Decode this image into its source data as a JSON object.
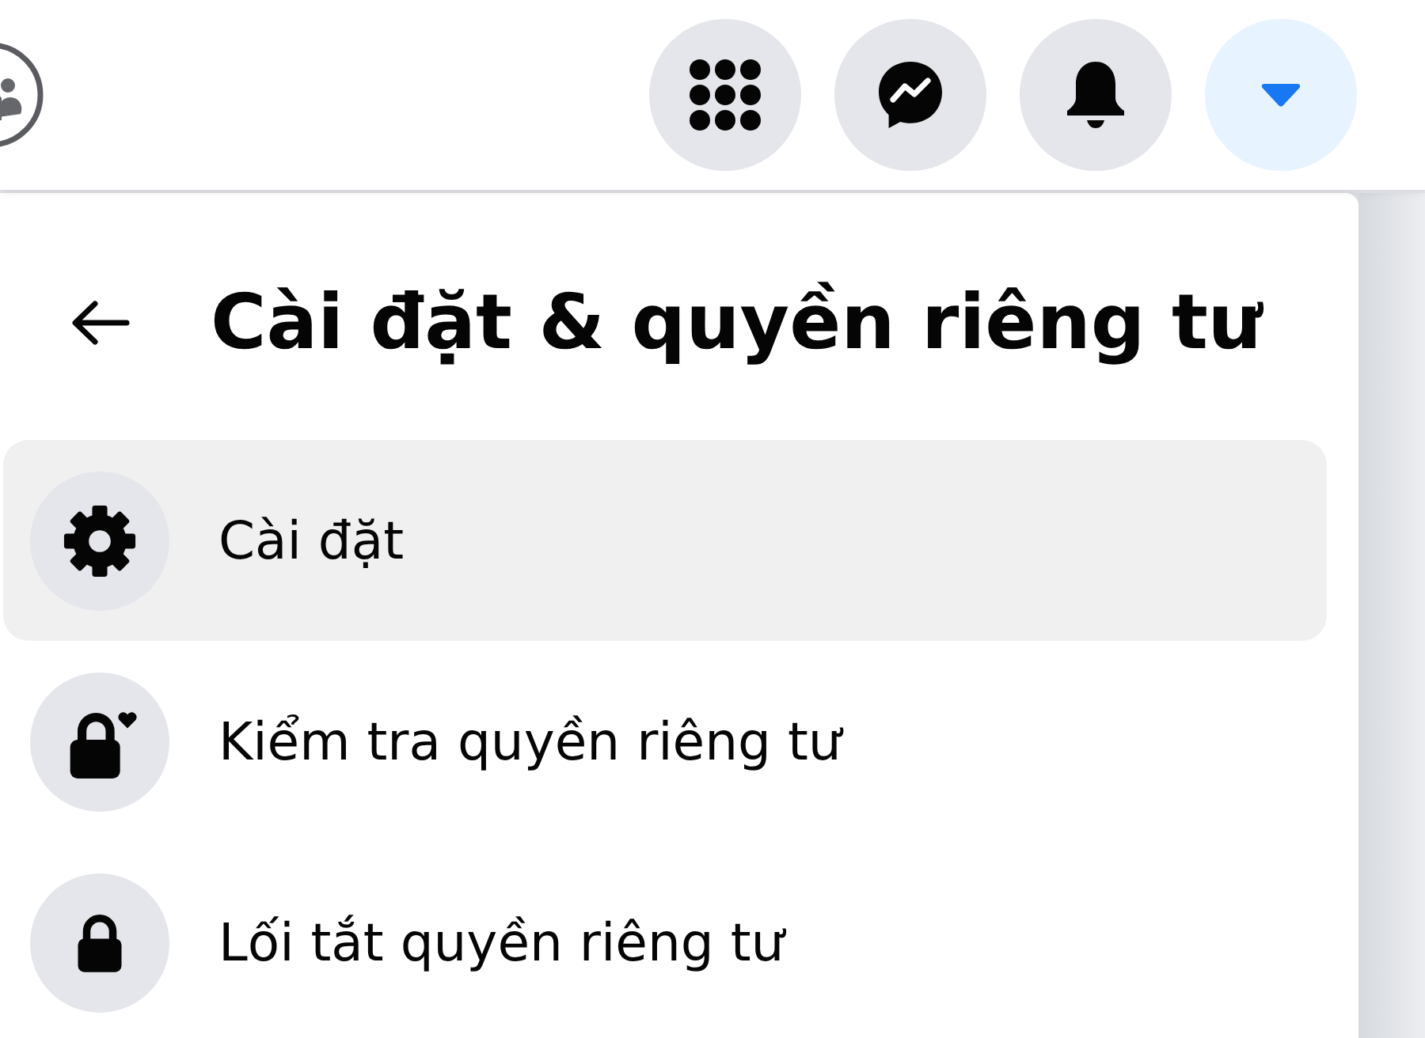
{
  "top_bar": {
    "buttons": [
      {
        "kind": "grid",
        "active": false
      },
      {
        "kind": "chat",
        "active": false
      },
      {
        "kind": "bell",
        "active": false
      },
      {
        "kind": "caret",
        "active": true
      }
    ]
  },
  "menu": {
    "title": "Cài đặt & quyền riêng tư",
    "items": [
      {
        "kind": "gear",
        "label": "Cài đặt",
        "selected": true
      },
      {
        "kind": "lock_heart",
        "label": "Kiểm tra quyền riêng tư",
        "selected": false
      },
      {
        "kind": "lock",
        "label": "Lối tắt quyền riêng tư",
        "selected": false
      }
    ]
  }
}
